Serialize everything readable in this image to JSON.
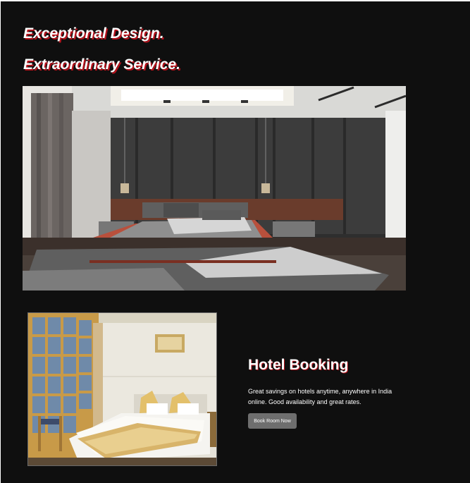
{
  "hero": {
    "line1": "Exceptional Design.",
    "line2": "Extraordinary Service."
  },
  "booking": {
    "title": "Hotel Booking",
    "description": "Great savings on hotels anytime, anywhere in India online. Good availability and great rates.",
    "button_label": "Book Room Now"
  },
  "colors": {
    "background": "#0f0f0f",
    "text_shadow": "#b5121b",
    "button": "#6e6e6e"
  }
}
